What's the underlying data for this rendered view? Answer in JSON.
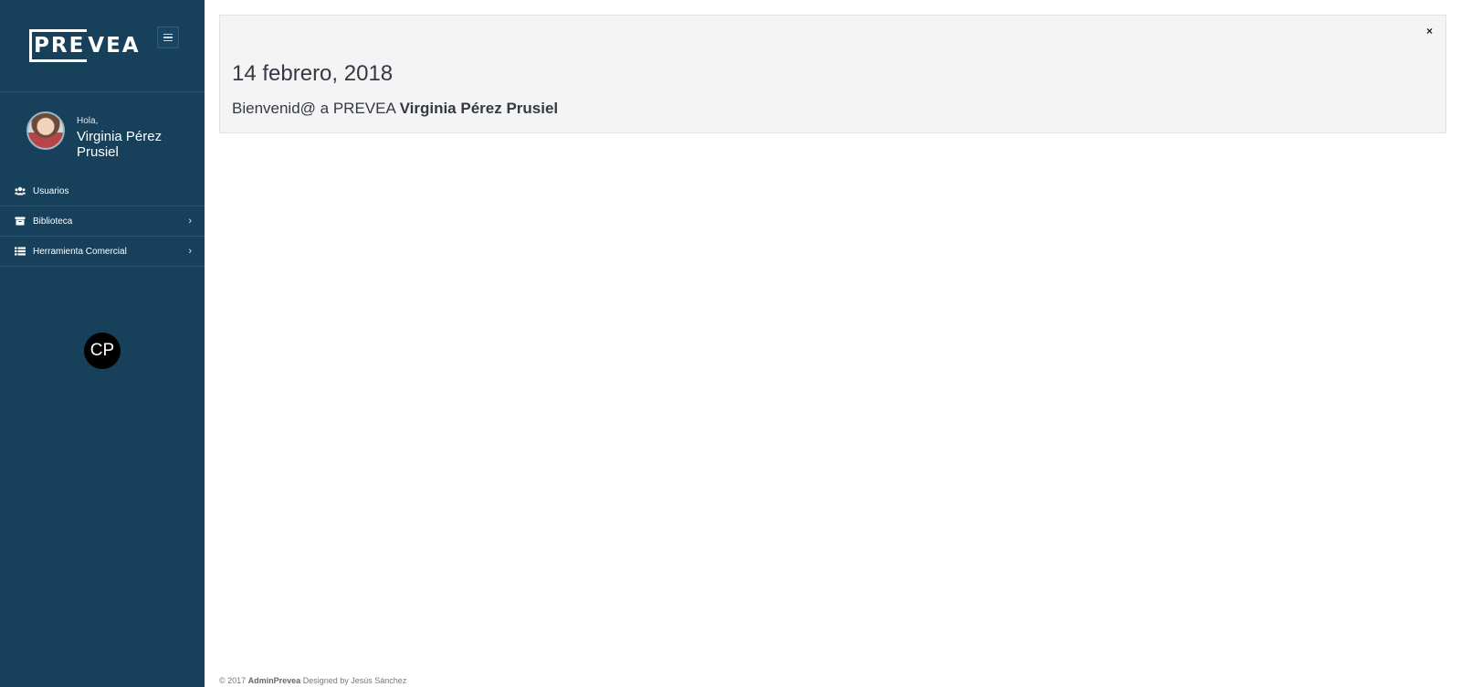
{
  "sidebar": {
    "logo_boxed": "PRE",
    "logo_rest": "VEA",
    "profile": {
      "greeting": "Hola,",
      "name": "Virginia Pérez Prusiel"
    },
    "items": [
      {
        "label": "Usuarios",
        "icon": "users-icon",
        "has_children": false
      },
      {
        "label": "Biblioteca",
        "icon": "archive-icon",
        "has_children": true
      },
      {
        "label": "Herramienta Comercial",
        "icon": "list-icon",
        "has_children": true
      }
    ],
    "badge": "CP"
  },
  "alert": {
    "close": "×",
    "date": "14 febrero, 2018",
    "welcome_prefix": "Bienvenid@ a PREVEA ",
    "welcome_name": "Virginia Pérez Prusiel"
  },
  "footer": {
    "copyright": "© 2017 ",
    "brand": "AdminPrevea",
    "designed": " Designed by Jesús Sánchez"
  },
  "colors": {
    "sidebar_bg": "#17405a",
    "alert_bg": "#f4f4f4"
  }
}
